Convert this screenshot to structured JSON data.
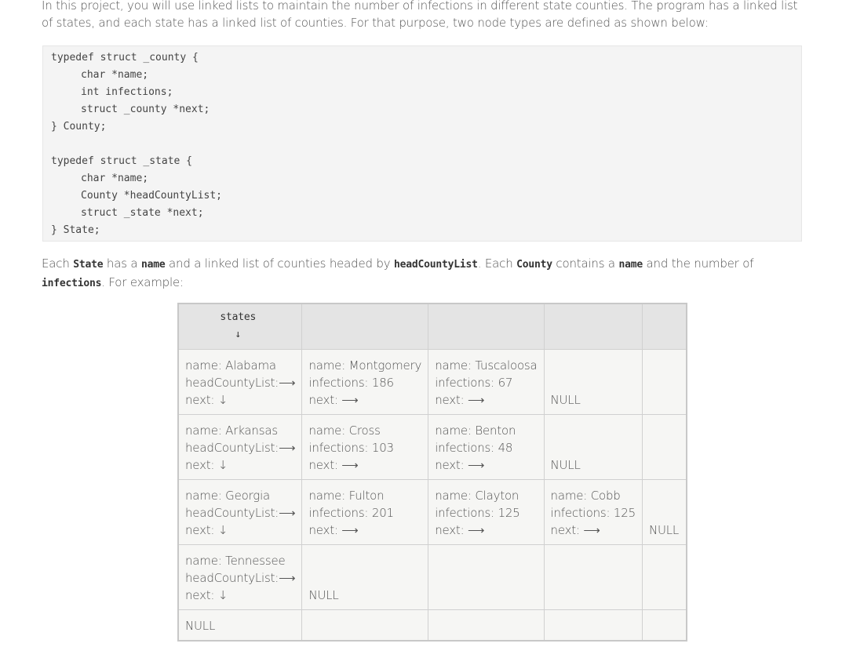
{
  "intro": "In this project, you will use linked lists to maintain the number of infections in different state counties. The program has a linked list of states, and each state has a linked list of counties. For that purpose, two node types are defined as shown below:",
  "code_lines": [
    {
      "text": "typedef struct _county {",
      "indent": false
    },
    {
      "text": "char *name;",
      "indent": true
    },
    {
      "text": "int infections;",
      "indent": true
    },
    {
      "text": "struct _county *next;",
      "indent": true
    },
    {
      "text": "} County;",
      "indent": false
    },
    {
      "text": "",
      "indent": false
    },
    {
      "text": "typedef struct _state {",
      "indent": false
    },
    {
      "text": "char *name;",
      "indent": true
    },
    {
      "text": "County *headCountyList;",
      "indent": true
    },
    {
      "text": "struct _state *next;",
      "indent": true
    },
    {
      "text": "} State;",
      "indent": false
    }
  ],
  "para": {
    "t1": "Each ",
    "c1": "State",
    "t2": " has a ",
    "c2": "name",
    "t3": " and a linked list of counties headed by ",
    "c3": "headCountyList",
    "t4": ". Each ",
    "c4": "County",
    "t5": " contains a ",
    "c5": "name",
    "t6": " and the number of ",
    "c6": "infections",
    "t7": ". For example:"
  },
  "diagram": {
    "header_label": "states",
    "header_arrow": "↓",
    "rows": [
      [
        [
          "name: Alabama",
          "headCountyList:⟶",
          "next: ↓"
        ],
        [
          "name: Montgomery",
          "infections: 186",
          "next: ⟶"
        ],
        [
          "name: Tuscaloosa",
          "infections: 67",
          "next: ⟶"
        ],
        [
          "NULL"
        ],
        []
      ],
      [
        [
          "name: Arkansas",
          "headCountyList:⟶",
          "next: ↓"
        ],
        [
          "name: Cross",
          "infections: 103",
          "next: ⟶"
        ],
        [
          "name: Benton",
          "infections: 48",
          "next: ⟶"
        ],
        [
          "NULL"
        ],
        []
      ],
      [
        [
          "name: Georgia",
          "headCountyList:⟶",
          "next: ↓"
        ],
        [
          "name: Fulton",
          "infections: 201",
          "next: ⟶"
        ],
        [
          "name: Clayton",
          "infections: 125",
          "next: ⟶"
        ],
        [
          "name: Cobb",
          "infections: 125",
          "next: ⟶"
        ],
        [
          "NULL"
        ]
      ],
      [
        [
          "name: Tennessee",
          "headCountyList:⟶",
          "next: ↓"
        ],
        [
          "NULL"
        ],
        [],
        [],
        []
      ],
      [
        [
          "NULL"
        ],
        [],
        [],
        [],
        []
      ]
    ]
  }
}
